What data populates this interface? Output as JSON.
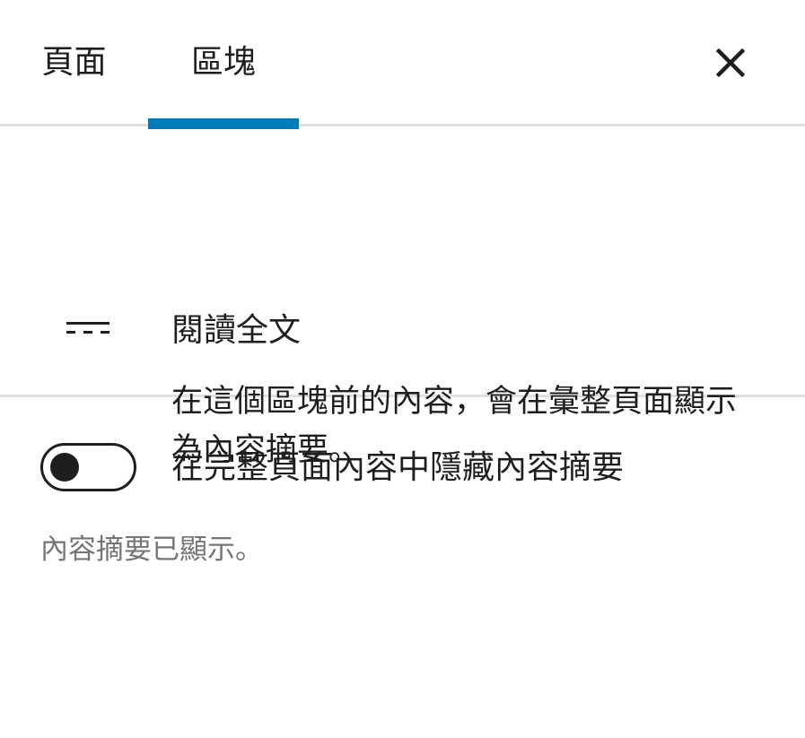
{
  "tabs": [
    {
      "label": "頁面",
      "active": false
    },
    {
      "label": "區塊",
      "active": true
    }
  ],
  "close_icon": "close-icon",
  "accent_color": "#007cba",
  "block": {
    "icon": "more-dashes-icon",
    "title": "閱讀全文",
    "description": "在這個區塊前的內容，會在彙整頁面顯示為內容摘要。"
  },
  "setting": {
    "toggle_on": false,
    "label": "在完整頁面內容中隱藏內容摘要",
    "help": "內容摘要已顯示。"
  }
}
